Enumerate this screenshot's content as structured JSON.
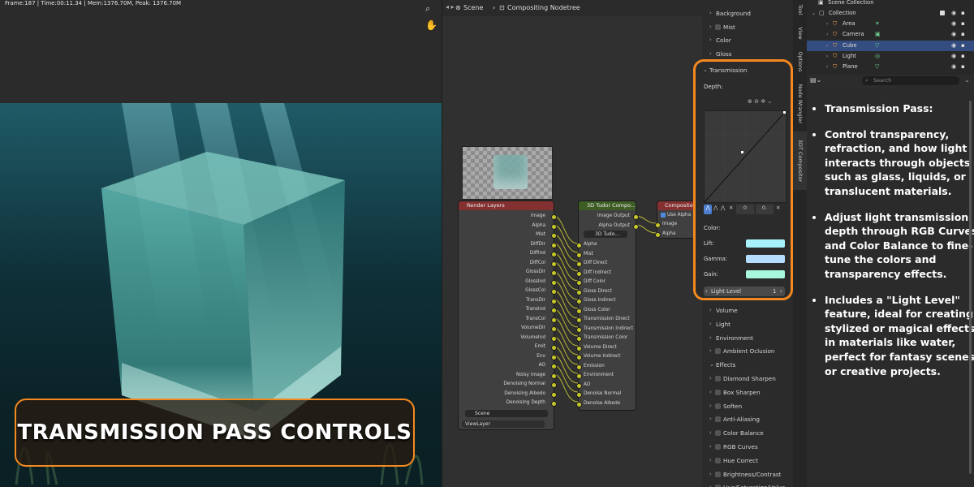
{
  "viewport": {
    "stats": "Frame:187 | Time:00:11.34 | Mem:1376.70M, Peak: 1376.70M",
    "overlay_title": "TRANSMISSION PASS CONTROLS"
  },
  "node_editor": {
    "breadcrumb": [
      "Scene",
      "Compositing Nodetree"
    ],
    "render_layers": {
      "title": "Render Layers",
      "outputs": [
        "Image",
        "Alpha",
        "Mist",
        "DiffDir",
        "DiffInd",
        "DiffCol",
        "GlossDir",
        "GlossInd",
        "GlossCol",
        "TransDir",
        "TransInd",
        "TransCol",
        "VolumeDir",
        "VolumeInd",
        "Emit",
        "Env",
        "AO",
        "Noisy Image",
        "Denoising Normal",
        "Denoising Albedo",
        "Denoising Depth"
      ],
      "scene": "Scene",
      "view_layer": "ViewLayer"
    },
    "tudor_node": {
      "title": "3D Tudor Compo...",
      "outputs": [
        "Image Output",
        "Alpha Output"
      ],
      "group_field": "3D Tudo...",
      "inputs": [
        "Alpha",
        "Mist",
        "Diff Direct",
        "Diff Indirect",
        "Diff Color",
        "Gloss Direct",
        "Gloss Indirect",
        "Gloss Color",
        "Transmission Direct",
        "Transmission Indirect",
        "Transmission Color",
        "Volume Direct",
        "Volume Indirect",
        "Emission",
        "Environment",
        "AO",
        "Denoise Normal",
        "Denoise Albedo"
      ]
    },
    "composite_node": {
      "title": "Composite",
      "use_alpha": "Use Alpha",
      "inputs": [
        "Image",
        "Alpha"
      ]
    }
  },
  "properties": {
    "top_items": [
      "Background",
      "Mist",
      "Color",
      "Gloss"
    ],
    "transmission": {
      "header": "Transmission",
      "depth_label": "Depth:",
      "curve_values": [
        "0",
        "0."
      ],
      "color_label": "Color:",
      "lift_label": "Lift:",
      "gamma_label": "Gamma:",
      "gain_label": "Gain:",
      "lift_color": "#a6f1fb",
      "gamma_color": "#b4dcfe",
      "gain_color": "#a7f8dc",
      "light_level_label": "Light Level",
      "light_level_value": "1"
    },
    "bottom_items": [
      "Volume",
      "Light",
      "Environment",
      "Ambient Oclusion"
    ],
    "effects_header": "Effects",
    "effects": [
      "Diamond Sharpen",
      "Box Sharpen",
      "Soften",
      "Anti-Aliasing",
      "Color Balance",
      "RGB Curves",
      "Hue Correct",
      "Brightness/Contrast",
      "Hue/Saturation/Value"
    ]
  },
  "side_tabs": [
    "Tool",
    "View",
    "Options",
    "Node Wrangler",
    "3DT Compositor"
  ],
  "outliner": {
    "header": "Scene Collection",
    "collection": "Collection",
    "items": [
      {
        "name": "Area",
        "icon_color": "#e59b4f",
        "selected": false
      },
      {
        "name": "Camera",
        "icon_color": "#e59b4f",
        "selected": false
      },
      {
        "name": "Cube",
        "icon_color": "#e59b4f",
        "selected": true
      },
      {
        "name": "Light",
        "icon_color": "#e59b4f",
        "selected": false
      },
      {
        "name": "Plane",
        "icon_color": "#e59b4f",
        "selected": false
      }
    ]
  },
  "search": {
    "placeholder": "Search"
  },
  "notes": [
    "Transmission Pass:",
    "Control transparency, refraction, and how light interacts through objects such as glass, liquids, or translucent materials.",
    "Adjust light transmission depth through RGB Curves and Color Balance to fine-tune the colors and transparency effects.",
    "Includes a \"Light Level\" feature, ideal for creating stylized or magical effects in materials like water, perfect for fantasy scenes or creative projects."
  ],
  "colors": {
    "accent_orange": "#f3891f",
    "selection_blue": "#334d80"
  }
}
